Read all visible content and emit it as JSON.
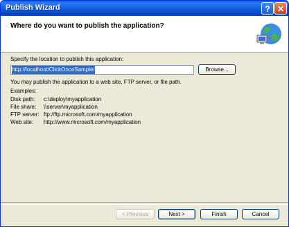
{
  "window": {
    "title": "Publish Wizard"
  },
  "header": {
    "title": "Where do you want to publish the application?"
  },
  "location": {
    "label": "Specify the location to publish this application:",
    "value": "http://localhost/ClickOnceSample/",
    "browse_label": "Browse..."
  },
  "info_text": "You may publish the application to a web site, FTP server, or file path.",
  "examples": {
    "heading": "Examples:",
    "rows": [
      {
        "key": "Disk path:",
        "value": "c:\\deploy\\myapplication"
      },
      {
        "key": "File share:",
        "value": "\\\\server\\myapplication"
      },
      {
        "key": "FTP server:",
        "value": "ftp://ftp.microsoft.com/myapplication"
      },
      {
        "key": "Web site:",
        "value": "http://www.microsoft.com/myapplication"
      }
    ]
  },
  "footer": {
    "previous": "< Previous",
    "next": "Next >",
    "finish": "Finish",
    "cancel": "Cancel"
  },
  "icons": {
    "help": "?",
    "close": "✕"
  }
}
